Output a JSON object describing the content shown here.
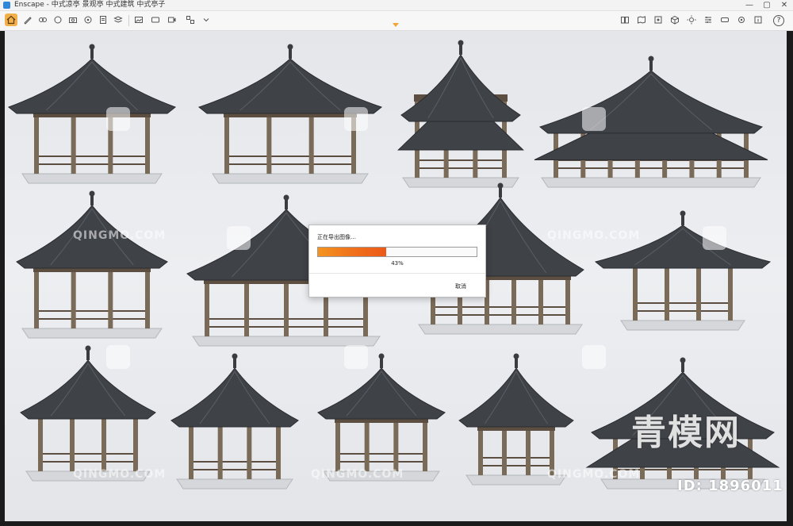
{
  "window": {
    "title": "Enscape - 中式凉亭 景观亭 中式建筑 中式亭子",
    "minimize": "—",
    "maximize": "▢",
    "close": "✕"
  },
  "toolbar": {
    "left_icons": [
      "home-icon",
      "pen-icon",
      "link-icon",
      "sync-icon",
      "camera-icon",
      "view-icon",
      "document-icon",
      "stack-icon",
      "image-export-icon",
      "panorama-icon",
      "video-export-icon",
      "batch-icon"
    ],
    "right_icons": [
      "book-icon",
      "map-icon",
      "capture-icon",
      "cube-icon",
      "sun-icon",
      "visual-settings-icon",
      "vr-icon",
      "settings-icon",
      "info-icon",
      "help-icon"
    ],
    "help_label": "?",
    "accent_color": "#f2b04a"
  },
  "dialog": {
    "title": "正在导出图像…",
    "progress": 0.43,
    "percent_label": "43%",
    "cancel_label": "取消",
    "progress_color": "#f0711b"
  },
  "watermarks": {
    "small": "QINGMO.COM",
    "logo_text": "青模网",
    "id_text": "ID: 1896011"
  }
}
